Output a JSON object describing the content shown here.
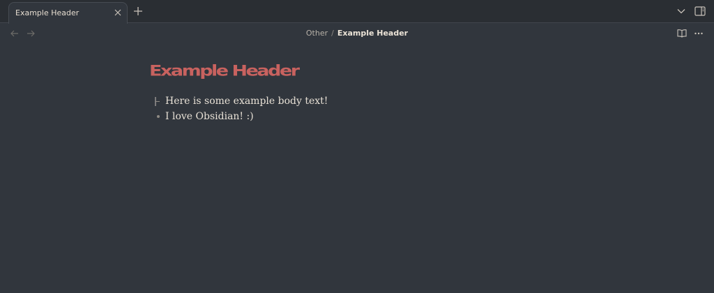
{
  "tab": {
    "title": "Example Header"
  },
  "breadcrumb": {
    "parent": "Other",
    "separator": "/",
    "current": "Example Header"
  },
  "note": {
    "title": "Example Header",
    "items": [
      {
        "text": "Here is some example body text!"
      },
      {
        "text": "I love Obsidian! :)"
      }
    ]
  },
  "colors": {
    "background": "#31363d",
    "header_accent": "#c8625f",
    "text": "#e8e1d6"
  },
  "icons": {
    "tab_close": "close-icon",
    "new_tab": "plus-icon",
    "tab_list": "chevron-down-icon",
    "sidebar_toggle": "sidebar-right-icon",
    "back": "arrow-left-icon",
    "forward": "arrow-right-icon",
    "reading_view": "book-open-icon",
    "more_options": "more-horizontal-icon"
  }
}
